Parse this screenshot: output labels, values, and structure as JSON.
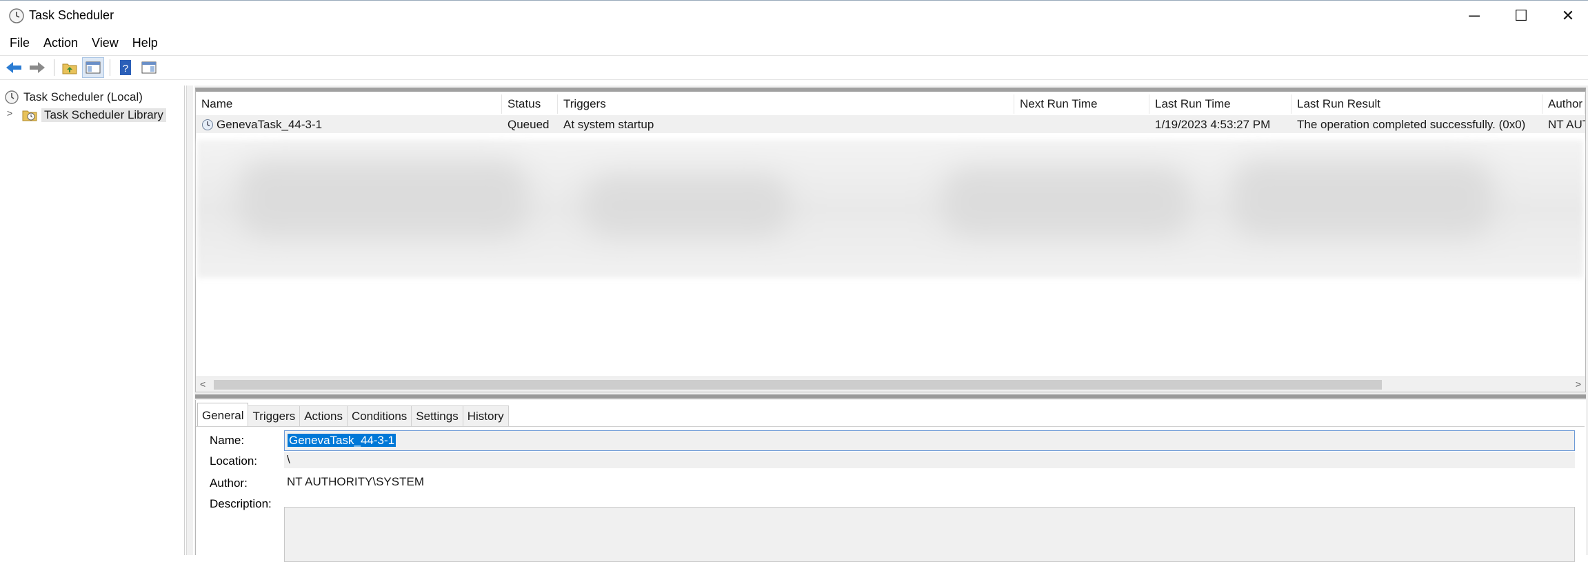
{
  "window": {
    "title": "Task Scheduler",
    "controls": {
      "minimize": "─",
      "maximize": "☐",
      "close": "✕"
    }
  },
  "menu": [
    "File",
    "Action",
    "View",
    "Help"
  ],
  "toolbar": {
    "buttons": [
      "back-arrow-icon",
      "forward-arrow-icon",
      "folder-up-icon",
      "show-hide-console-tree-icon",
      "help-icon",
      "show-hide-action-pane-icon"
    ]
  },
  "tree": {
    "root": "Task Scheduler (Local)",
    "library": "Task Scheduler Library",
    "expander": ">"
  },
  "task_list": {
    "columns": [
      "Name",
      "Status",
      "Triggers",
      "Next Run Time",
      "Last Run Time",
      "Last Run Result",
      "Author"
    ],
    "rows": [
      {
        "name": "GenevaTask_44-3-1",
        "status": "Queued",
        "triggers": "At system startup",
        "next_run_time": "",
        "last_run_time": "1/19/2023 4:53:27 PM",
        "last_run_result": "The operation completed successfully. (0x0)",
        "author": "NT AUT"
      }
    ],
    "scroll_left": "<",
    "scroll_right": ">"
  },
  "details": {
    "tabs": [
      "General",
      "Triggers",
      "Actions",
      "Conditions",
      "Settings",
      "History"
    ],
    "active_tab": "General",
    "name_label": "Name:",
    "name_value": "GenevaTask_44-3-1",
    "location_label": "Location:",
    "location_value": "\\",
    "author_label": "Author:",
    "author_value": "NT AUTHORITY\\SYSTEM",
    "description_label": "Description:",
    "description_value": ""
  },
  "colors": {
    "selection": "#0078d7",
    "accent_blue": "#2b7cd3"
  }
}
